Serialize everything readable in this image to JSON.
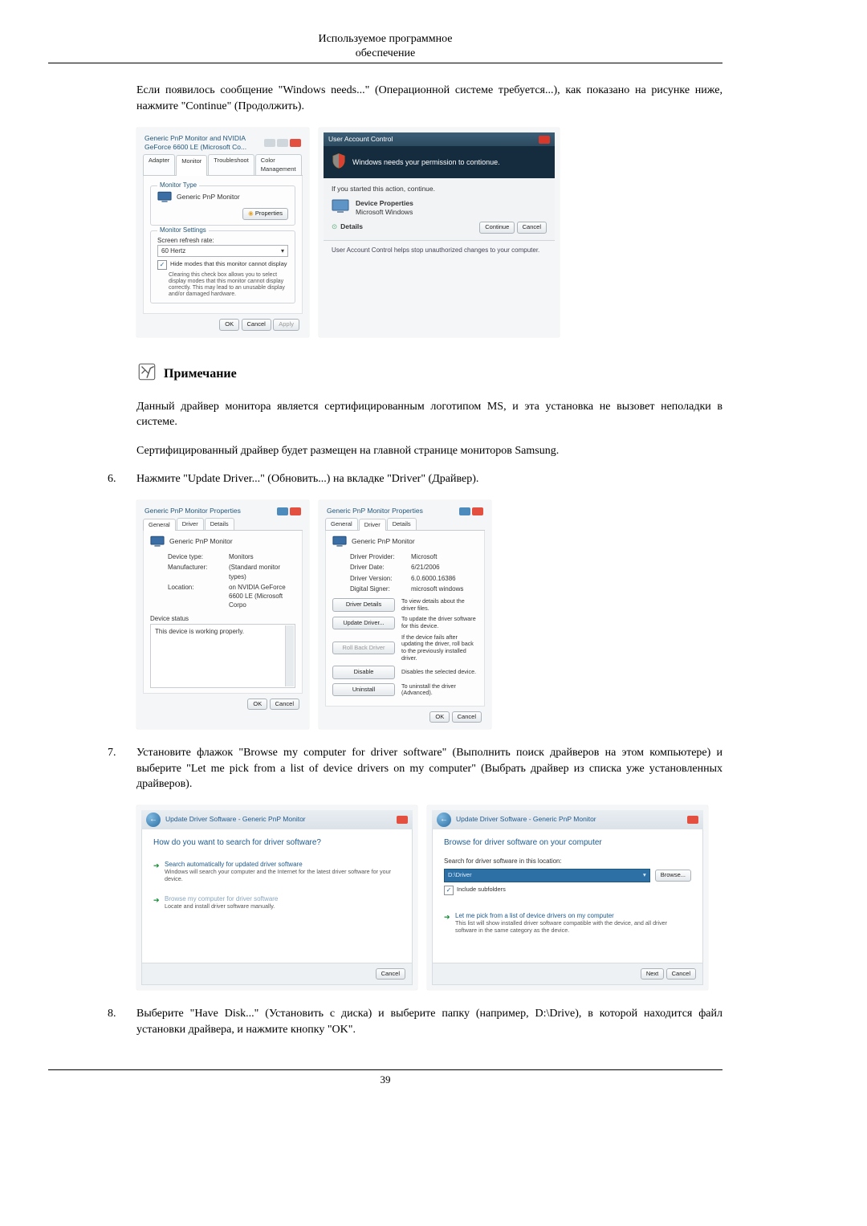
{
  "header": {
    "line1": "Используемое программное",
    "line2": "обеспечение"
  },
  "intro": "Если появилось сообщение \"Windows needs...\" (Операционной системе требуется...), как показано на рисунке ниже, нажмите \"Continue\" (Продолжить).",
  "shot_monitor": {
    "title": "Generic PnP Monitor and NVIDIA GeForce 6600 LE (Microsoft Co...",
    "tabs": [
      "Adapter",
      "Monitor",
      "Troubleshoot",
      "Color Management"
    ],
    "active_tab": 1,
    "section1_title": "Monitor Type",
    "monitor_name": "Generic PnP Monitor",
    "properties_btn": "Properties",
    "section2_title": "Monitor Settings",
    "refresh_label": "Screen refresh rate:",
    "refresh_value": "60 Hertz",
    "hide_modes_label": "Hide modes that this monitor cannot display",
    "hide_modes_desc": "Clearing this check box allows you to select display modes that this monitor cannot display correctly. This may lead to an unusable display and/or damaged hardware.",
    "ok": "OK",
    "cancel": "Cancel",
    "apply": "Apply"
  },
  "shot_uac": {
    "title": "User Account Control",
    "band": "Windows needs your permission to contionue.",
    "line1": "If you started this action, continue.",
    "app_l1": "Device Properties",
    "app_l2": "Microsoft Windows",
    "details": "Details",
    "continue": "Continue",
    "cancel": "Cancel",
    "footer": "User Account Control helps stop unauthorized changes to your computer."
  },
  "note": {
    "label": "Примечание",
    "p1": "Данный драйвер монитора является сертифицированным логотипом MS, и эта установка не вызовет неполадки в системе.",
    "p2": "Сертифицированный драйвер будет размещен на главной странице мониторов Samsung."
  },
  "step6": {
    "num": "6.",
    "text": "Нажмите \"Update Driver...\" (Обновить...) на вкладке \"Driver\" (Драйвер)."
  },
  "shot_props_general": {
    "title": "Generic PnP Monitor Properties",
    "tabs": [
      "General",
      "Driver",
      "Details"
    ],
    "active_tab": 0,
    "monitor_name": "Generic PnP Monitor",
    "rows": [
      {
        "k": "Device type:",
        "v": "Monitors"
      },
      {
        "k": "Manufacturer:",
        "v": "(Standard monitor types)"
      },
      {
        "k": "Location:",
        "v": "on NVIDIA GeForce 6600 LE (Microsoft Corpo"
      }
    ],
    "status_title": "Device status",
    "status_text": "This device is working properly.",
    "ok": "OK",
    "cancel": "Cancel"
  },
  "shot_props_driver": {
    "title": "Generic PnP Monitor Properties",
    "tabs": [
      "General",
      "Driver",
      "Details"
    ],
    "active_tab": 1,
    "monitor_name": "Generic PnP Monitor",
    "rows": [
      {
        "k": "Driver Provider:",
        "v": "Microsoft"
      },
      {
        "k": "Driver Date:",
        "v": "6/21/2006"
      },
      {
        "k": "Driver Version:",
        "v": "6.0.6000.16386"
      },
      {
        "k": "Digital Signer:",
        "v": "microsoft windows"
      }
    ],
    "actions": [
      {
        "btn": "Driver Details",
        "desc": "To view details about the driver files."
      },
      {
        "btn": "Update Driver...",
        "desc": "To update the driver software for this device."
      },
      {
        "btn": "Roll Back Driver",
        "desc": "If the device fails after updating the driver, roll back to the previously installed driver."
      },
      {
        "btn": "Disable",
        "desc": "Disables the selected device."
      },
      {
        "btn": "Uninstall",
        "desc": "To uninstall the driver (Advanced)."
      }
    ],
    "ok": "OK",
    "cancel": "Cancel"
  },
  "step7": {
    "num": "7.",
    "text": "Установите флажок \"Browse my computer for driver software\" (Выполнить поиск драйверов на этом компьютере) и выберите \"Let me pick from a list of device drivers on my computer\" (Выбрать драйвер из списка уже установленных драйверов)."
  },
  "shot_wiz1": {
    "crumb": "Update Driver Software - Generic PnP Monitor",
    "heading": "How do you want to search for driver software?",
    "opt1_t": "Search automatically for updated driver software",
    "opt1_d": "Windows will search your computer and the Internet for the latest driver software for your device.",
    "opt2_t": "Browse my computer for driver software",
    "opt2_d": "Locate and install driver software manually.",
    "cancel": "Cancel"
  },
  "shot_wiz2": {
    "crumb": "Update Driver Software - Generic PnP Monitor",
    "heading": "Browse for driver software on your computer",
    "search_label": "Search for driver software in this location:",
    "path_value": "D:\\Driver",
    "browse": "Browse...",
    "include_sub": "Include subfolders",
    "opt_t": "Let me pick from a list of device drivers on my computer",
    "opt_d": "This list will show installed driver software compatible with the device, and all driver software in the same category as the device.",
    "next": "Next",
    "cancel": "Cancel"
  },
  "step8": {
    "num": "8.",
    "text": "Выберите \"Have Disk...\" (Установить с диска) и выберите папку (например, D:\\Drive), в которой находится файл установки драйвера, и нажмите кнопку \"OK\"."
  },
  "footer": {
    "page": "39"
  }
}
